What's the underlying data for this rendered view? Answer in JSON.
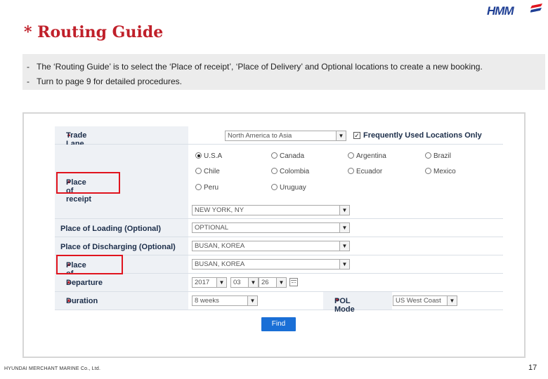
{
  "brand": {
    "logo_text": "HMM",
    "accent": "#c0202a",
    "blue": "#1f3f94"
  },
  "title": "* Routing Guide",
  "notes": [
    {
      "dash": "-",
      "text": "The ‘Routing Guide’ is to select the ‘Place of receipt’, ‘Place of Delivery’ and Optional locations to create a new booking."
    },
    {
      "dash": "-",
      "text": "Turn to page 9 for detailed procedures."
    }
  ],
  "form": {
    "trade_lane": {
      "label": "Trade Lane",
      "value": "North America to Asia",
      "checkbox_label": "Frequently Used Locations Only",
      "checked": true
    },
    "place_of_receipt": {
      "label": "Place of receipt",
      "countries": [
        "U.S.A",
        "Canada",
        "Argentina",
        "Brazil",
        "Chile",
        "Colombia",
        "Ecuador",
        "Mexico",
        "Peru",
        "Uruguay"
      ],
      "selected_country": "U.S.A",
      "location": "NEW YORK, NY"
    },
    "place_of_loading": {
      "label": "Place of Loading (Optional)",
      "value": "OPTIONAL"
    },
    "place_of_discharging": {
      "label": "Place of Discharging (Optional)",
      "value": "BUSAN, KOREA"
    },
    "place_of_delivery": {
      "label": "Place of delivery",
      "value": "BUSAN, KOREA"
    },
    "departure": {
      "label": "Departure",
      "year": "2017",
      "month": "03",
      "day": "26"
    },
    "duration": {
      "label": "Duration",
      "value": "8 weeks"
    },
    "pol_mode": {
      "label": "POL Mode",
      "value": "US West Coast"
    },
    "find_label": "Find"
  },
  "footer": "HYUNDAI MERCHANT MARINE Co., Ltd.",
  "page_number": "17"
}
